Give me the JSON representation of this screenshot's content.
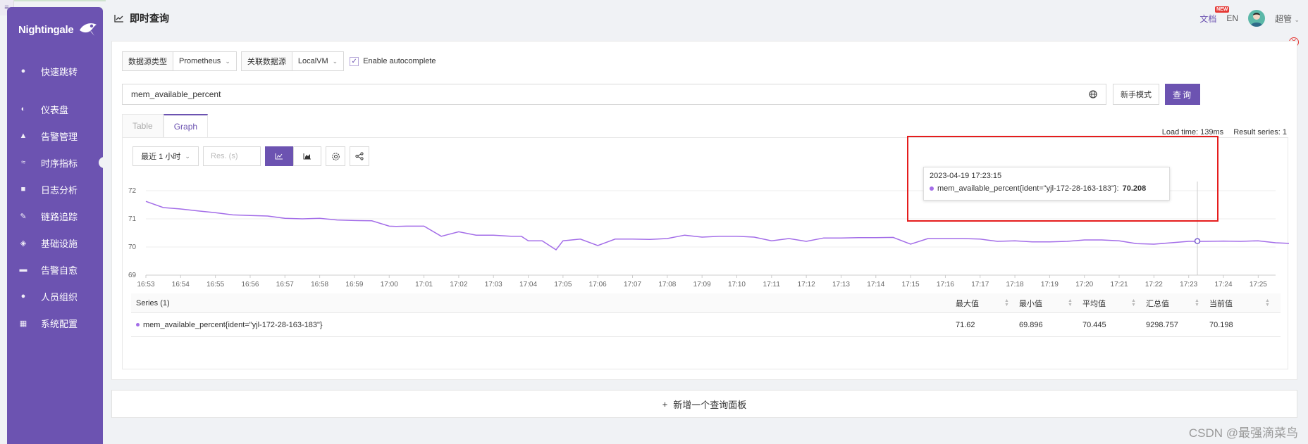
{
  "app": {
    "brand": "Nightingale"
  },
  "sidebar": {
    "items": [
      {
        "label": "快速跳转",
        "icon": "search-icon"
      },
      {
        "label": "仪表盘",
        "icon": "dashboard-icon"
      },
      {
        "label": "告警管理",
        "icon": "alarm-icon"
      },
      {
        "label": "时序指标",
        "icon": "line-chart-icon",
        "active": true
      },
      {
        "label": "日志分析",
        "icon": "document-icon"
      },
      {
        "label": "链路追踪",
        "icon": "trace-icon"
      },
      {
        "label": "基础设施",
        "icon": "infra-icon"
      },
      {
        "label": "告警自愈",
        "icon": "terminal-icon"
      },
      {
        "label": "人员组织",
        "icon": "user-icon"
      },
      {
        "label": "系统配置",
        "icon": "grid-icon"
      }
    ]
  },
  "header": {
    "title": "即时查询",
    "doc": "文档",
    "new_badge": "NEW",
    "lang": "EN",
    "user": "超管"
  },
  "query_bar": {
    "datasource_type_label": "数据源类型",
    "datasource_type_value": "Prometheus",
    "datasource_label": "关联数据源",
    "datasource_value": "LocalVM",
    "autocomplete_label": "Enable autocomplete",
    "promql": "mem_available_percent",
    "novice_button": "新手模式",
    "query_button": "查询"
  },
  "tabs": [
    {
      "label": "Table"
    },
    {
      "label": "Graph",
      "active": true
    }
  ],
  "stats": {
    "load_time": "Load time: 139ms",
    "result_series": "Result series: 1"
  },
  "graph_toolbar": {
    "range": "最近 1 小时",
    "res_placeholder": "Res. (s)"
  },
  "tooltip": {
    "time": "2023-04-19 17:23:15",
    "series": "mem_available_percent{ident=\"yjl-172-28-163-183\"}:",
    "value": "70.208"
  },
  "legend": {
    "headers": {
      "series": "Series (1)",
      "max": "最大值",
      "min": "最小值",
      "avg": "平均值",
      "sum": "汇总值",
      "current": "当前值"
    },
    "row": {
      "name": "mem_available_percent{ident=\"yjl-172-28-163-183\"}",
      "max": "71.62",
      "min": "69.896",
      "avg": "70.445",
      "sum": "9298.757",
      "current": "70.198"
    }
  },
  "add_panel": "新增一个查询面板",
  "watermark": "CSDN @最强滴菜鸟",
  "colors": {
    "primary": "#6c53b1",
    "series": "#a36de8",
    "highlight": "#e51c1c"
  },
  "chart_data": {
    "type": "line",
    "ylim": [
      69,
      72
    ],
    "yticks": [
      "72",
      "71",
      "70",
      "69"
    ],
    "xticks": [
      "16:53",
      "16:54",
      "16:55",
      "16:56",
      "16:57",
      "16:58",
      "16:59",
      "17:00",
      "17:01",
      "17:02",
      "17:03",
      "17:04",
      "17:05",
      "17:06",
      "17:07",
      "17:08",
      "17:09",
      "17:10",
      "17:11",
      "17:12",
      "17:13",
      "17:14",
      "17:15",
      "17:16",
      "17:17",
      "17:18",
      "17:19",
      "17:20",
      "17:21",
      "17:22",
      "17:23",
      "17:24",
      "17:25"
    ],
    "series": [
      {
        "name": "mem_available_percent{ident=\"yjl-172-28-163-183\"}",
        "x_minutes": [
          0,
          0.5,
          1,
          1.5,
          2,
          2.5,
          3,
          3.5,
          4,
          4.5,
          5,
          5.5,
          6,
          6.5,
          7,
          7.2,
          7.5,
          8,
          8.5,
          9,
          9.5,
          10,
          10.5,
          10.8,
          11,
          11.4,
          11.8,
          12,
          12.5,
          13,
          13.5,
          14,
          14.5,
          15,
          15.5,
          16,
          16.5,
          17,
          17.5,
          18,
          18.5,
          19,
          19.5,
          20,
          20.5,
          21,
          21.5,
          22,
          22.5,
          23,
          23.5,
          24,
          24.5,
          25,
          25.5,
          26,
          26.5,
          27,
          27.5,
          28,
          28.5,
          29,
          29.5,
          30,
          30.5,
          31,
          31.5,
          32,
          32.5,
          33,
          33.5
        ],
        "values": [
          71.62,
          71.4,
          71.35,
          71.28,
          71.22,
          71.14,
          71.12,
          71.1,
          71.02,
          71.0,
          71.02,
          70.96,
          70.94,
          70.93,
          70.74,
          70.73,
          70.74,
          70.74,
          70.38,
          70.54,
          70.42,
          70.42,
          70.38,
          70.38,
          70.22,
          70.22,
          69.9,
          70.22,
          70.28,
          70.05,
          70.28,
          70.28,
          70.27,
          70.3,
          70.42,
          70.35,
          70.38,
          70.38,
          70.35,
          70.22,
          70.3,
          70.2,
          70.32,
          70.32,
          70.33,
          70.33,
          70.34,
          70.1,
          70.3,
          70.3,
          70.3,
          70.28,
          70.2,
          70.22,
          70.18,
          70.18,
          70.2,
          70.25,
          70.25,
          70.22,
          70.12,
          70.1,
          70.15,
          70.2,
          70.2,
          70.21,
          70.2,
          70.22,
          70.15,
          70.12,
          70.2
        ]
      }
    ],
    "hover": {
      "time": "17:23:15",
      "value": 70.208
    }
  }
}
